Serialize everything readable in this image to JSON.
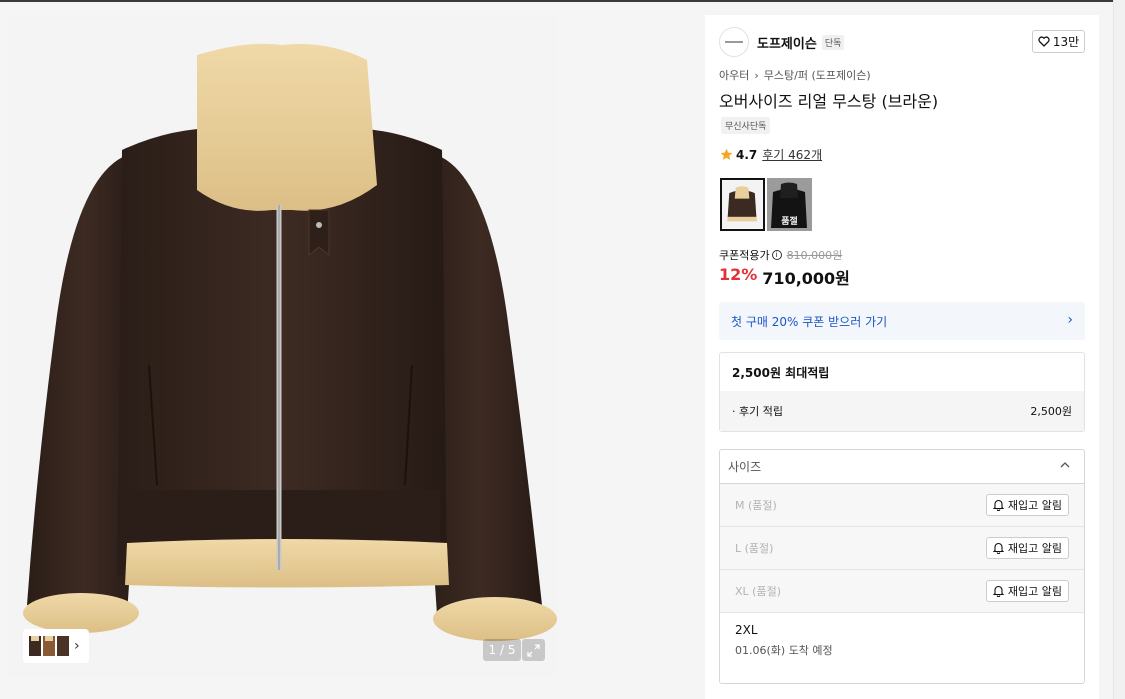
{
  "gallery": {
    "counter": "1 / 5",
    "thumb_chevron": "chevron-right-icon",
    "expand_icon": "expand-icon"
  },
  "brand": {
    "name": "도프제이슨",
    "tag": "단독",
    "likes": "13만",
    "like_icon": "heart-icon"
  },
  "breadcrumb": {
    "items": [
      "아우터",
      "무스탕/퍼 (도프제이슨)"
    ]
  },
  "product": {
    "title": "오버사이즈 리얼 무스탕 (브라운)",
    "badge": "무신사단독",
    "rating": "4.7",
    "reviews_label": "후기 462개",
    "star_color": "#f5a623"
  },
  "colors": {
    "options": [
      {
        "name": "브라운",
        "selected": true,
        "soldout": false
      },
      {
        "name": "블랙",
        "selected": false,
        "soldout": true,
        "soldout_label": "품절"
      }
    ]
  },
  "price": {
    "coupon_label": "쿠폰적용가",
    "original": "810,000원",
    "discount": "12%",
    "final": "710,000원",
    "discount_color": "#e0303a"
  },
  "coupon": {
    "banner": "첫 구매 20% 쿠폰 받으러 가기",
    "color": "#1a56c8"
  },
  "points": {
    "header": "2,500원 최대적립",
    "rows": [
      {
        "label": "· 후기 적립",
        "value": "2,500원"
      }
    ]
  },
  "size": {
    "placeholder": "사이즈",
    "options": [
      {
        "name": "M (품절)",
        "action": "재입고 알림"
      },
      {
        "name": "L (품절)",
        "action": "재입고 알림"
      },
      {
        "name": "XL (품절)",
        "action": "재입고 알림"
      }
    ],
    "available": {
      "name": "2XL",
      "note": "01.06(화) 도착 예정"
    }
  }
}
